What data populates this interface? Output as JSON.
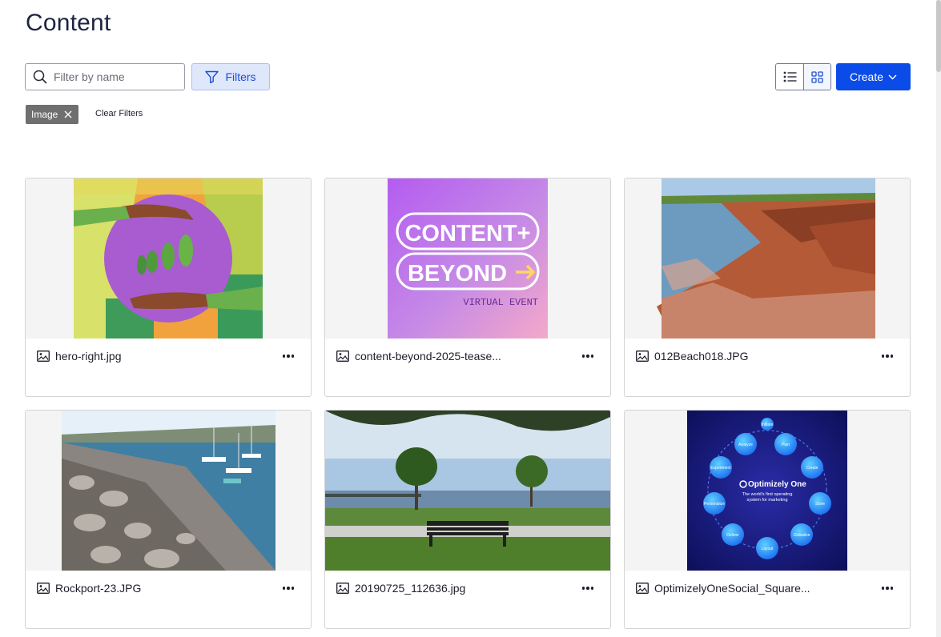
{
  "page": {
    "title": "Content"
  },
  "toolbar": {
    "search_placeholder": "Filter by name",
    "search_value": "",
    "filters_label": "Filters",
    "view_modes": [
      "list",
      "grid"
    ],
    "active_view": "grid",
    "create_label": "Create"
  },
  "active_filters": {
    "chips": [
      "Image"
    ],
    "clear_label": "Clear Filters"
  },
  "items": [
    {
      "name": "hero-right.jpg",
      "type": "image"
    },
    {
      "name": "content-beyond-2025-tease...",
      "type": "image",
      "thumb_text": [
        "CONTENT+",
        "BEYOND",
        "VIRTUAL EVENT"
      ]
    },
    {
      "name": "012Beach018.JPG",
      "type": "image"
    },
    {
      "name": "Rockport-23.JPG",
      "type": "image"
    },
    {
      "name": "20190725_112636.jpg",
      "type": "image"
    },
    {
      "name": "OptimizelyOneSocial_Square...",
      "type": "image",
      "thumb_text": [
        "Optimizely One",
        "The world's first operating system for marketing",
        "Initiate",
        "Plan",
        "Create",
        "Store",
        "Globalize",
        "Layout",
        "Deliver",
        "Personalize",
        "Experiment",
        "Analyze"
      ]
    }
  ],
  "colors": {
    "accent": "#0b4ce8",
    "filters_bg": "#dfe7fb",
    "chip_bg": "#6f6f6f"
  }
}
